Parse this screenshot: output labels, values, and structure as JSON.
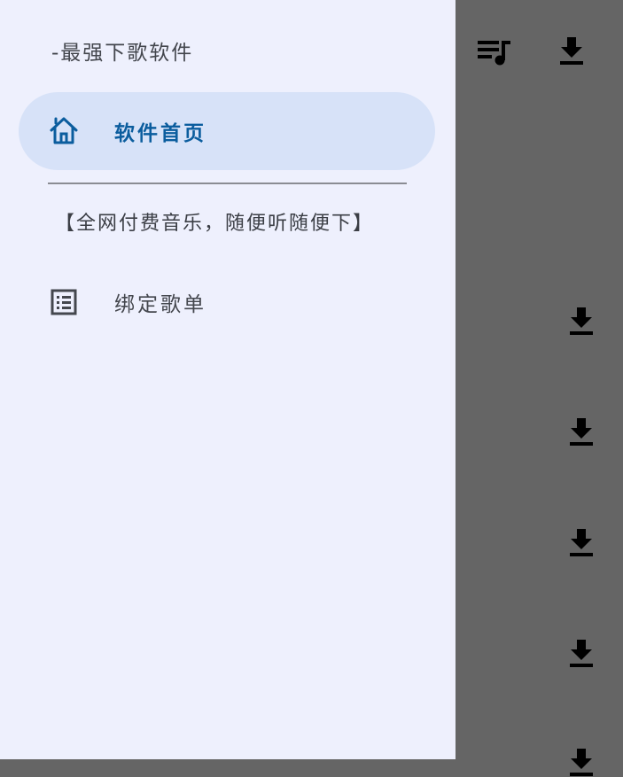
{
  "drawer": {
    "header": "-最强下歌软件",
    "items": [
      {
        "label": "软件首页",
        "icon": "home-icon",
        "active": true
      },
      {
        "label": "绑定歌单",
        "icon": "list-icon",
        "active": false
      }
    ],
    "section_label": "【全网付费音乐，随便听随便下】"
  },
  "background": {
    "toolbar_icons": [
      "playlist-music-icon",
      "download-icon"
    ],
    "row_icons": [
      "download-icon",
      "download-icon",
      "download-icon",
      "download-icon",
      "download-icon"
    ]
  },
  "colors": {
    "drawer_bg": "#eef0fd",
    "active_item_bg": "#d7e2f8",
    "active_item_text": "#0b5d9e",
    "scrim": "#656565"
  }
}
